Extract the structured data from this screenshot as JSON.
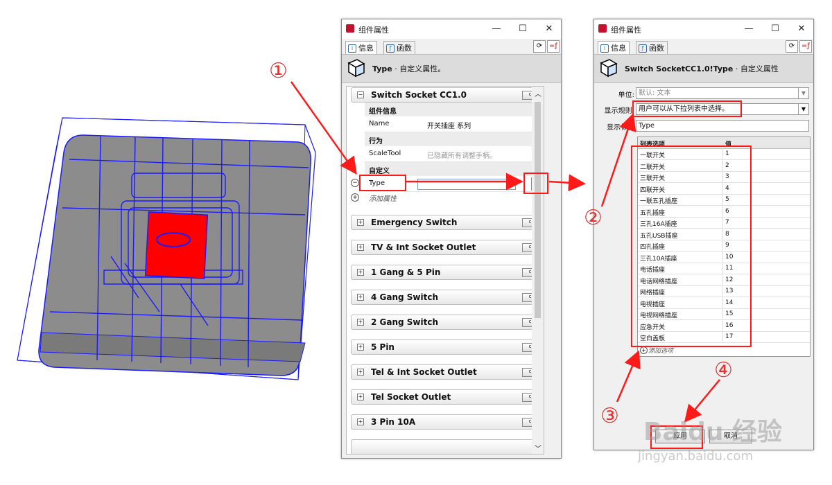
{
  "left_window": {
    "title": "组件属性",
    "tabs": [
      {
        "label": "信息"
      },
      {
        "label": "函数"
      }
    ],
    "header_title": "Type",
    "header_subtitle": " · 自定义属性。",
    "component_name": "Switch Socket CC1.0",
    "groups": {
      "info": "组件信息",
      "behavior": "行为",
      "custom": "自定义"
    },
    "rows": {
      "name_key": "Name",
      "name_value": "开关插座     系列",
      "scaletool_key": "ScaleTool",
      "scaletool_value": "已隐藏所有调整手柄。",
      "type_key": "Type",
      "add_attribute": "添加属性"
    },
    "unit_badge": "cm",
    "components": [
      "Emergency Switch",
      "TV & Int Socket Outlet",
      "1 Gang & 5 Pin",
      "4 Gang Switch",
      "2 Gang Switch",
      "5 Pin",
      "Tel & Int Socket Outlet",
      "Tel Socket Outlet",
      "3 Pin 10A"
    ]
  },
  "right_window": {
    "title": "组件属性",
    "tabs": [
      {
        "label": "信息"
      },
      {
        "label": "函数"
      }
    ],
    "header_title": "Switch SocketCC1.0!Type",
    "header_subtitle": " · 自定义属性",
    "unit_label": "单位:",
    "unit_value": "默认: 文本",
    "display_rule_label": "显示规则:",
    "display_rule_value": "用户可以从下拉列表中选择。",
    "display_label_label": "显示标签",
    "display_label_value": "Type",
    "table_headers": [
      "列表选项",
      "值"
    ],
    "options": [
      {
        "label": "一联开关",
        "value": "1"
      },
      {
        "label": "二联开关",
        "value": "2"
      },
      {
        "label": "三联开关",
        "value": "3"
      },
      {
        "label": "四联开关",
        "value": "4"
      },
      {
        "label": "一联五孔插座",
        "value": "5"
      },
      {
        "label": "五孔插座",
        "value": "6"
      },
      {
        "label": "三孔16A插座",
        "value": "7"
      },
      {
        "label": "五孔USB插座",
        "value": "8"
      },
      {
        "label": "四孔插座",
        "value": "9"
      },
      {
        "label": "三孔10A插座",
        "value": "10"
      },
      {
        "label": "电话插座",
        "value": "11"
      },
      {
        "label": "电话网络插座",
        "value": "12"
      },
      {
        "label": "网络插座",
        "value": "13"
      },
      {
        "label": "电视插座",
        "value": "14"
      },
      {
        "label": "电视网络插座",
        "value": "15"
      },
      {
        "label": "应急开关",
        "value": "16"
      },
      {
        "label": "空白盖板",
        "value": "17"
      }
    ],
    "add_option": "添加选项",
    "apply_button": "应用",
    "cancel_button": "取消"
  },
  "annotations": [
    "①",
    "②",
    "③",
    "④"
  ],
  "watermark": {
    "brand": "Baidu 经验",
    "url": "jingyan.baidu.com"
  },
  "colors": {
    "accent_red": "#ff1a1a",
    "wire_blue": "#1a1aff",
    "model_gray": "#8c8c8c",
    "model_red": "#ff0000"
  }
}
